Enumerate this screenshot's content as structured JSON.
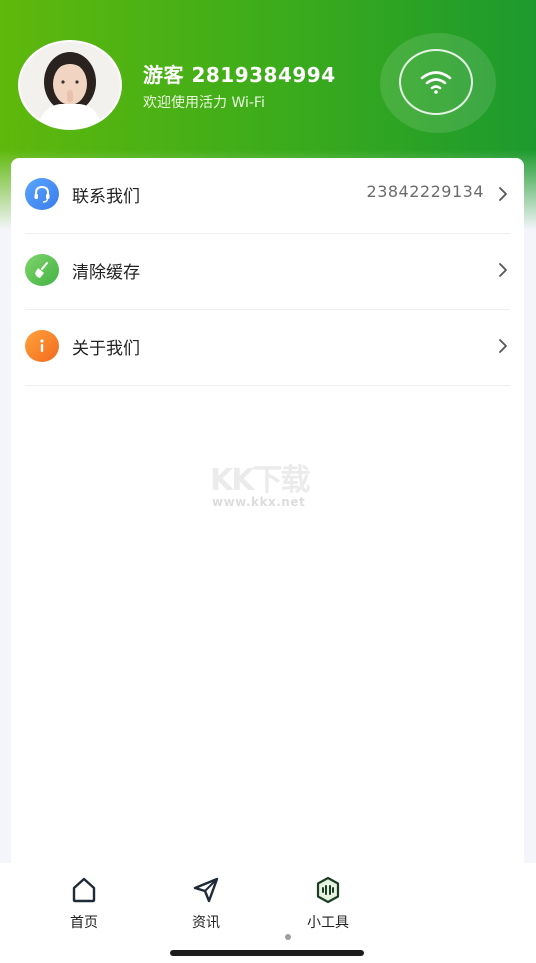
{
  "profile": {
    "username": "游客 2819384994",
    "welcome": "欢迎使用活力 Wi-Fi"
  },
  "menu": [
    {
      "label": "联系我们",
      "value": "23842229134",
      "icon": "headset-icon",
      "color": "#4a8df6"
    },
    {
      "label": "清除缓存",
      "value": "",
      "icon": "broom-icon",
      "color": "#5cc24e"
    },
    {
      "label": "关于我们",
      "value": "",
      "icon": "info-icon",
      "color": "#f6852c"
    }
  ],
  "watermark": {
    "big": "KK下载",
    "small": "www.kkx.net"
  },
  "tabs": [
    {
      "label": "首页",
      "icon": "home-icon"
    },
    {
      "label": "资讯",
      "icon": "send-icon"
    },
    {
      "label": "小工具",
      "icon": "tools-icon"
    }
  ],
  "colors": {
    "header_start": "#5fb80c",
    "header_end": "#1d9a2e"
  }
}
